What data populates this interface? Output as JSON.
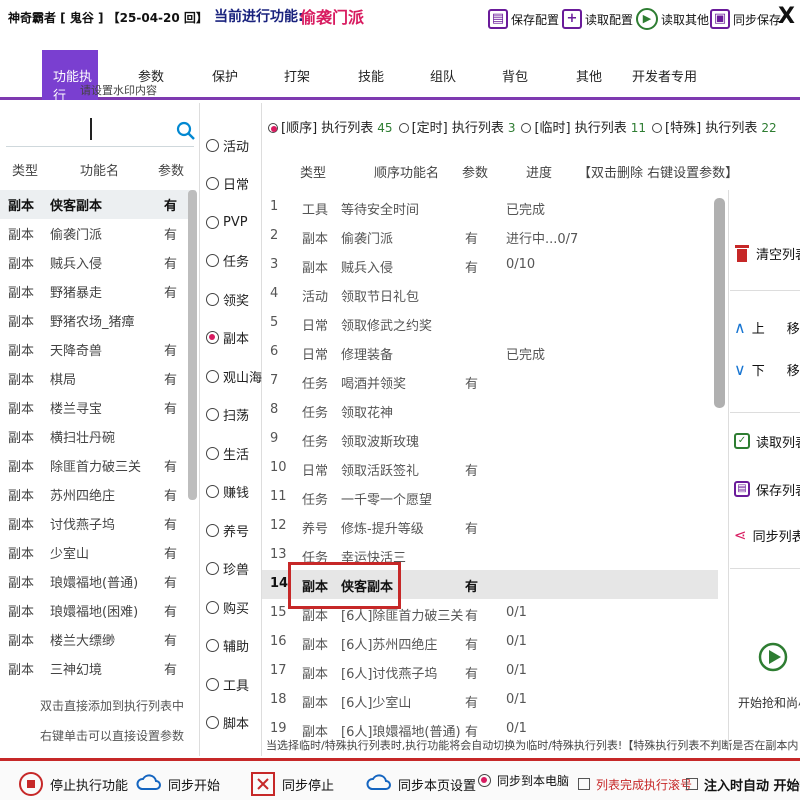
{
  "app": {
    "title": "神奇霸者 [ 鬼谷 ] 【25-04-20 回】",
    "current_func_label": "当前进行功能:",
    "current_func_value": "偷袭门派",
    "close": "X"
  },
  "toolbar": {
    "save_config": "保存配置",
    "read_config": "读取配置",
    "read_other": "读取其他",
    "sync_save": "同步保存"
  },
  "tabs": [
    "功能执行",
    "参数",
    "保护",
    "打架",
    "技能",
    "组队",
    "背包",
    "其他",
    "开发者专用"
  ],
  "watermark": "请设置水印内容",
  "left_list": {
    "headers": {
      "type": "类型",
      "name": "功能名",
      "param": "参数"
    },
    "rows": [
      {
        "type": "副本",
        "name": "侠客副本",
        "param": "有",
        "selected": true
      },
      {
        "type": "副本",
        "name": "偷袭门派",
        "param": "有"
      },
      {
        "type": "副本",
        "name": "贼兵入侵",
        "param": "有"
      },
      {
        "type": "副本",
        "name": "野猪暴走",
        "param": "有"
      },
      {
        "type": "副本",
        "name": "野猪农场_猪瘴",
        "param": ""
      },
      {
        "type": "副本",
        "name": "天降奇兽",
        "param": "有"
      },
      {
        "type": "副本",
        "name": "棋局",
        "param": "有"
      },
      {
        "type": "副本",
        "name": "楼兰寻宝",
        "param": "有"
      },
      {
        "type": "副本",
        "name": "横扫壮丹碗",
        "param": ""
      },
      {
        "type": "副本",
        "name": "除匪首力破三关",
        "param": "有"
      },
      {
        "type": "副本",
        "name": "苏州四绝庄",
        "param": "有"
      },
      {
        "type": "副本",
        "name": "讨伐燕子坞",
        "param": "有"
      },
      {
        "type": "副本",
        "name": "少室山",
        "param": "有"
      },
      {
        "type": "副本",
        "name": "琅嬛福地(普通)",
        "param": "有"
      },
      {
        "type": "副本",
        "name": "琅嬛福地(困难)",
        "param": "有"
      },
      {
        "type": "副本",
        "name": "楼兰大缥缈",
        "param": "有"
      },
      {
        "type": "副本",
        "name": "三神幻境",
        "param": "有"
      }
    ],
    "hint1": "双击直接添加到执行列表中",
    "hint2": "右键单击可以直接设置参数"
  },
  "categories": [
    {
      "label": "活动",
      "checked": false
    },
    {
      "label": "日常",
      "checked": false
    },
    {
      "label": "PVP",
      "checked": false
    },
    {
      "label": "任务",
      "checked": false
    },
    {
      "label": "领奖",
      "checked": false
    },
    {
      "label": "副本",
      "checked": true
    },
    {
      "label": "观山海",
      "checked": false
    },
    {
      "label": "扫荡",
      "checked": false
    },
    {
      "label": "生活",
      "checked": false
    },
    {
      "label": "赚钱",
      "checked": false
    },
    {
      "label": "养号",
      "checked": false
    },
    {
      "label": "珍兽",
      "checked": false
    },
    {
      "label": "购买",
      "checked": false
    },
    {
      "label": "辅助",
      "checked": false
    },
    {
      "label": "工具",
      "checked": false
    },
    {
      "label": "脚本",
      "checked": false
    }
  ],
  "list_tabs": [
    {
      "label": "[顺序] 执行列表",
      "count": "45",
      "checked": true
    },
    {
      "label": "[定时] 执行列表",
      "count": "3",
      "checked": false
    },
    {
      "label": "[临时] 执行列表",
      "count": "11",
      "checked": false
    },
    {
      "label": "[特殊] 执行列表",
      "count": "22",
      "checked": false
    }
  ],
  "main_list": {
    "headers": {
      "type": "类型",
      "name": "顺序功能名",
      "param": "参数",
      "progress": "进度",
      "tip": "【双击删除 右键设置参数】"
    },
    "rows": [
      {
        "n": "1",
        "type": "工具",
        "name": "等待安全时间",
        "param": "",
        "progress": "已完成"
      },
      {
        "n": "2",
        "type": "副本",
        "name": "偷袭门派",
        "param": "有",
        "progress": "进行中...0/7"
      },
      {
        "n": "3",
        "type": "副本",
        "name": "贼兵入侵",
        "param": "有",
        "progress": "0/10"
      },
      {
        "n": "4",
        "type": "活动",
        "name": "领取节日礼包",
        "param": "",
        "progress": ""
      },
      {
        "n": "5",
        "type": "日常",
        "name": "领取修武之约奖",
        "param": "",
        "progress": ""
      },
      {
        "n": "6",
        "type": "日常",
        "name": "修理装备",
        "param": "",
        "progress": "已完成"
      },
      {
        "n": "7",
        "type": "任务",
        "name": "喝酒并领奖",
        "param": "有",
        "progress": ""
      },
      {
        "n": "8",
        "type": "任务",
        "name": "领取花神",
        "param": "",
        "progress": ""
      },
      {
        "n": "9",
        "type": "任务",
        "name": "领取波斯玫瑰",
        "param": "",
        "progress": ""
      },
      {
        "n": "10",
        "type": "日常",
        "name": "领取活跃签礼",
        "param": "有",
        "progress": ""
      },
      {
        "n": "11",
        "type": "任务",
        "name": "一千零一个愿望",
        "param": "",
        "progress": ""
      },
      {
        "n": "12",
        "type": "养号",
        "name": "修炼-提升等级",
        "param": "有",
        "progress": ""
      },
      {
        "n": "13",
        "type": "任务",
        "name": "幸运快活三",
        "param": "",
        "progress": ""
      },
      {
        "n": "14",
        "type": "副本",
        "name": "侠客副本",
        "param": "有",
        "progress": "",
        "selected": true
      },
      {
        "n": "15",
        "type": "副本",
        "name": "[6人]除匪首力破三关",
        "param": "有",
        "progress": "0/1"
      },
      {
        "n": "16",
        "type": "副本",
        "name": "[6人]苏州四绝庄",
        "param": "有",
        "progress": "0/1"
      },
      {
        "n": "17",
        "type": "副本",
        "name": "[6人]讨伐燕子坞",
        "param": "有",
        "progress": "0/1"
      },
      {
        "n": "18",
        "type": "副本",
        "name": "[6人]少室山",
        "param": "有",
        "progress": "0/1"
      },
      {
        "n": "19",
        "type": "副本",
        "name": "[6人]琅嬛福地(普通)",
        "param": "有",
        "progress": "0/1"
      }
    ],
    "footer_note": "当选择临时/特殊执行列表时,执行功能将会自动切换为临时/特殊执行列表!【特殊执行列表不判断是否在副本内"
  },
  "right_panel": {
    "clear": "清空列表",
    "up": "上",
    "up_move": "移",
    "down": "下",
    "down_move": "移",
    "read_list": "读取列表",
    "save_list": "保存列表",
    "sync_list": "同步列表",
    "start": "开始抢和尚小"
  },
  "bottom": {
    "stop_exec": "停止执行功能",
    "sync_start": "同步开始",
    "sync_stop": "同步停止",
    "sync_page": "同步本页设置",
    "sync_pc": "同步到本电脑",
    "list_done": "列表完成执行滚号",
    "auto_start": "注入时自动 开始执"
  },
  "colors": {
    "accent": "#7a3fd0",
    "highlight": "#d81b60",
    "alert": "#c62828"
  }
}
